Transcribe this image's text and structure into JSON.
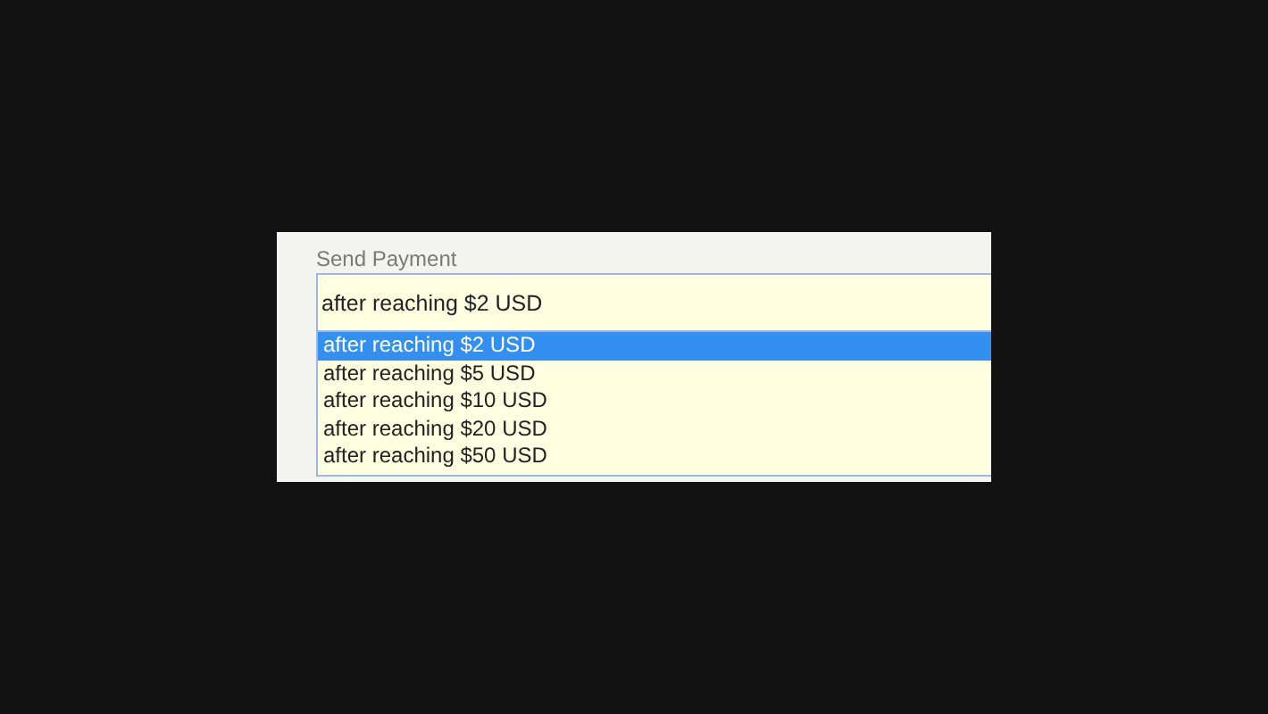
{
  "field": {
    "label": "Send Payment",
    "value": "after reaching $2 USD"
  },
  "options": [
    {
      "label": "after reaching $2 USD",
      "selected": true
    },
    {
      "label": "after reaching $5 USD",
      "selected": false
    },
    {
      "label": "after reaching $10 USD",
      "selected": false
    },
    {
      "label": "after reaching $20 USD",
      "selected": false
    },
    {
      "label": "after reaching $50 USD",
      "selected": false
    }
  ]
}
